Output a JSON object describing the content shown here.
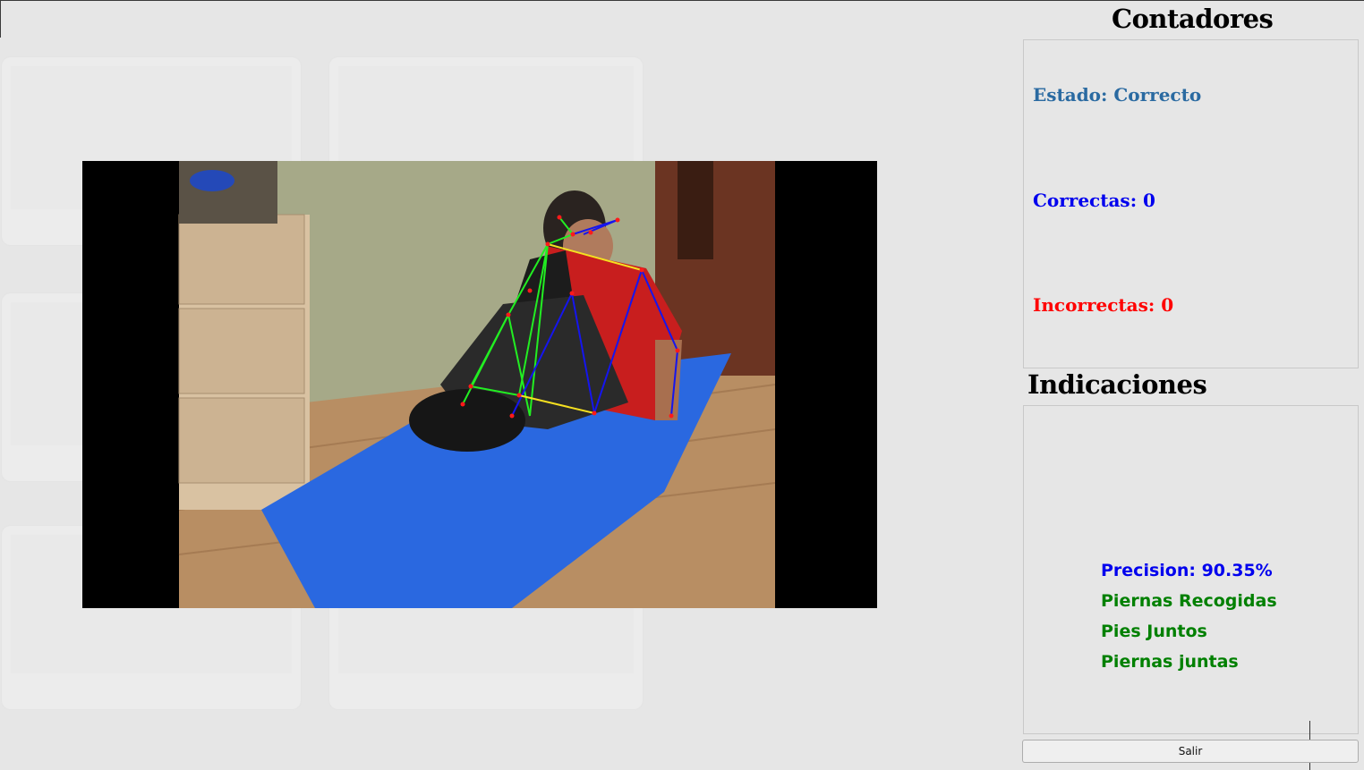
{
  "counters": {
    "title": "Contadores",
    "estado": "Estado: Correcto",
    "correctas": "Correctas: 0",
    "incorrectas": "Incorrectas: 0"
  },
  "indications": {
    "title": "Indicaciones",
    "lines": [
      "Precision: 90.35%",
      "Piernas Recogidas",
      "Pies Juntos",
      "Piernas juntas"
    ]
  },
  "exit_button": "Salir",
  "colors": {
    "estado": "#2a6aa1",
    "correctas": "#0000ee",
    "incorrectas": "#ff0000",
    "precision": "#0000ee",
    "indication_ok": "#008000"
  }
}
